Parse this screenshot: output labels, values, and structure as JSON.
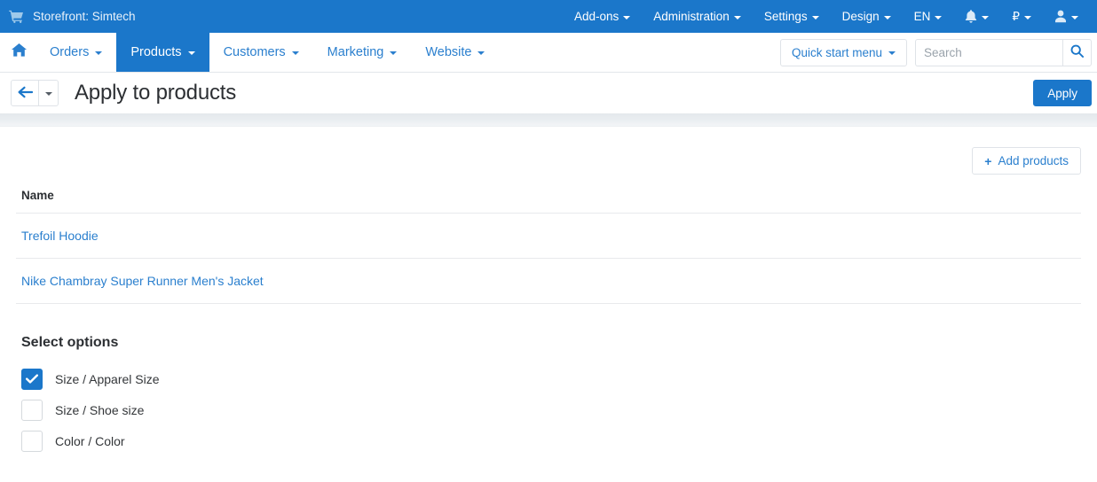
{
  "topbar": {
    "cart_icon": "cart-icon",
    "storefront_label": "Storefront: Simtech",
    "menus": [
      {
        "label": "Add-ons",
        "name": "add-ons"
      },
      {
        "label": "Administration",
        "name": "administration"
      },
      {
        "label": "Settings",
        "name": "settings"
      },
      {
        "label": "Design",
        "name": "design"
      },
      {
        "label": "EN",
        "name": "language"
      }
    ],
    "notifications_icon": "bell-icon",
    "currency_symbol": "₽",
    "account_icon": "user-icon"
  },
  "navbar": {
    "home_icon": "home-icon",
    "items": [
      {
        "label": "Orders",
        "name": "orders",
        "active": false
      },
      {
        "label": "Products",
        "name": "products",
        "active": true
      },
      {
        "label": "Customers",
        "name": "customers",
        "active": false
      },
      {
        "label": "Marketing",
        "name": "marketing",
        "active": false
      },
      {
        "label": "Website",
        "name": "website",
        "active": false
      }
    ],
    "quick_start_label": "Quick start menu",
    "search_placeholder": "Search",
    "search_value": "",
    "search_icon": "search-icon"
  },
  "titlebar": {
    "back_icon": "arrow-left-icon",
    "back_caret_icon": "chevron-down-icon",
    "title": "Apply to products",
    "apply_label": "Apply"
  },
  "main": {
    "add_products_label": "Add products",
    "add_products_icon": "plus-icon",
    "table": {
      "columns": [
        "Name"
      ],
      "rows": [
        {
          "name": "Trefoil Hoodie"
        },
        {
          "name": "Nike Chambray Super Runner Men's Jacket"
        }
      ]
    },
    "select_options_heading": "Select options",
    "options": [
      {
        "label": "Size / Apparel Size",
        "checked": true
      },
      {
        "label": "Size / Shoe size",
        "checked": false
      },
      {
        "label": "Color / Color",
        "checked": false
      }
    ]
  },
  "colors": {
    "brand_blue": "#1b77ca",
    "link_blue": "#2a7fce",
    "border_grey": "#dfe3e8",
    "separator_grey": "#e7ebee"
  }
}
